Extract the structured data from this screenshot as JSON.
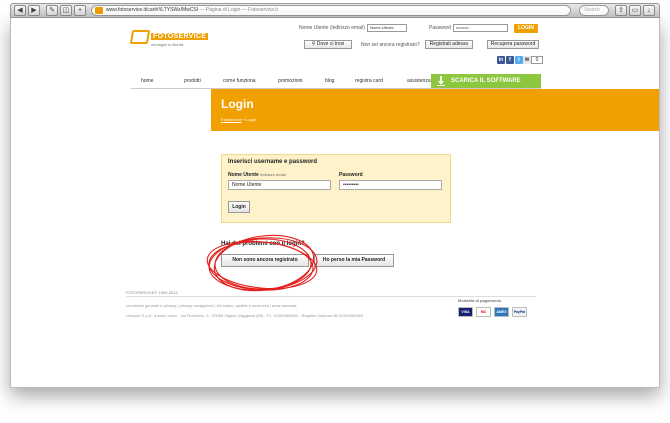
{
  "browser": {
    "url": "www.fotoservice.it/cart#!/LTYSWz/MwCSI",
    "page_title": "— Pagina di Login — Fotoservice.it",
    "search_placeholder": "Search"
  },
  "header": {
    "logo_text": "FOTOSERVICE",
    "logo_tagline": "immagini in libertà",
    "username_label": "Nome Utente (indirizzo email)",
    "username_value": "Nome Utente",
    "password_label": "Password",
    "password_value": "•••••••••",
    "login_button": "LOGIN",
    "where_button": "Dove ci trovi",
    "not_registered_text": "Non sei ancora registrato?",
    "register_button": "Registrati adesso",
    "recover_button": "Recupera password",
    "cart_count": "0"
  },
  "nav": {
    "items": [
      "home",
      "prodotti",
      "come funziona",
      "promozioni",
      "blog",
      "registra card",
      "assistenza"
    ],
    "download_label": "SCARICA IL SOFTWARE"
  },
  "banner": {
    "title": "Login",
    "breadcrumb_home": "Fotoservice",
    "breadcrumb_sep": "»",
    "breadcrumb_current": "Login"
  },
  "login_form": {
    "heading": "Inserisci username e password",
    "username_label": "Nome Utente",
    "username_hint": "indirizzo email",
    "username_value": "Nome Utente",
    "password_label": "Password",
    "password_value": "•••••••••",
    "submit_label": "Login"
  },
  "problems": {
    "title": "Hai dei problemi con il login?",
    "not_registered_button": "Non sono ancora registrato",
    "lost_password_button": "Ho perso la mia Password"
  },
  "footer": {
    "copyright": "FOTOSERVICE© 1999-2013",
    "links": "condizioni generali e privacy  |  privacy navigazioni  |  chi siamo, qualità e sicurezza  |  area riservata",
    "address": "Unicolor S.p.A. a socio unico - via Fiumicino, 3 - 20083 Vigano Gaggiano (MI) - P.I. 01259960960 - Registro Imprese MI 01259960960",
    "payment_label": "Modalità di pagamento",
    "cards": [
      "VISA",
      "MC",
      "AMEX",
      "PayPal"
    ]
  }
}
